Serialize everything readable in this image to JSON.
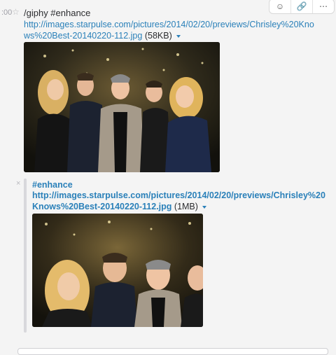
{
  "message": {
    "timestamp": ":00",
    "text": "/giphy #enhance",
    "link": "http://images.starpulse.com/pictures/2014/02/20/previews/Chrisley%20Knows%20Best-20140220-112.jpg",
    "size": "(58KB)"
  },
  "toolbar": {
    "react_icon": "emoji-add-icon",
    "link_icon": "link-icon",
    "more_icon": "more-icon",
    "more_label": "⋯"
  },
  "attachment": {
    "title": "#enhance",
    "link": "http://images.starpulse.com/pictures/2014/02/20/previews/Chrisley%20Knows%20Best-20140220-112.jpg",
    "size": "(1MB)"
  },
  "colors": {
    "link": "#2a80b9",
    "background": "#f4f4f4",
    "photo_background": "#1b1a14"
  }
}
